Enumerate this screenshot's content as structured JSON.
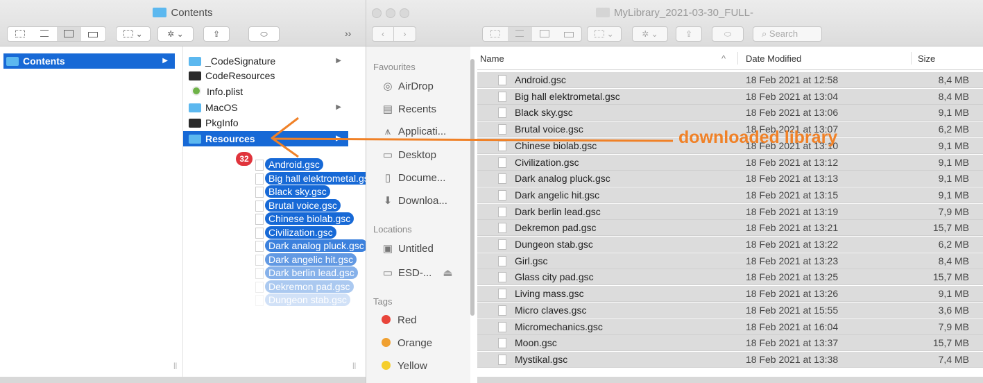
{
  "left_window": {
    "title": "Contents",
    "more_label": "››",
    "column1": [
      {
        "label": "Contents"
      }
    ],
    "column2": [
      {
        "label": "_CodeSignature",
        "icon": "folder-icon",
        "has_children": true
      },
      {
        "label": "CodeResources",
        "icon": "executable-icon",
        "has_children": false
      },
      {
        "label": "Info.plist",
        "icon": "plist-icon",
        "has_children": false
      },
      {
        "label": "MacOS",
        "icon": "folder-icon",
        "has_children": true
      },
      {
        "label": "PkgInfo",
        "icon": "executable-icon",
        "has_children": false
      },
      {
        "label": "Resources",
        "icon": "folder-icon",
        "has_children": true,
        "selected": true
      }
    ],
    "drag": {
      "count": "32",
      "items": [
        "Android.gsc",
        "Big hall elektrometal.gsc",
        "Black sky.gsc",
        "Brutal voice.gsc",
        "Chinese biolab.gsc",
        "Civilization.gsc",
        "Dark analog pluck.gsc",
        "Dark angelic hit.gsc",
        "Dark berlin lead.gsc",
        "Dekremon pad.gsc",
        "Dungeon stab.gsc"
      ]
    }
  },
  "right_window": {
    "title": "MyLibrary_2021-03-30_FULL-",
    "search_placeholder": "Search",
    "sidebar": {
      "favourites_header": "Favourites",
      "favourites": [
        {
          "label": "AirDrop",
          "icon": "airdrop-icon"
        },
        {
          "label": "Recents",
          "icon": "recents-icon"
        },
        {
          "label": "Applicati...",
          "icon": "applications-icon"
        },
        {
          "label": "Desktop",
          "icon": "desktop-icon"
        },
        {
          "label": "Docume...",
          "icon": "documents-icon"
        },
        {
          "label": "Downloa...",
          "icon": "downloads-icon"
        }
      ],
      "locations_header": "Locations",
      "locations": [
        {
          "label": "Untitled",
          "icon": "disk-icon"
        },
        {
          "label": "ESD-...",
          "icon": "disk-icon"
        }
      ],
      "eject_symbol": "⏏",
      "tags_header": "Tags",
      "tags": [
        {
          "label": "Red",
          "color": "#e8443a"
        },
        {
          "label": "Orange",
          "color": "#f0a030"
        },
        {
          "label": "Yellow",
          "color": "#f5ce2b"
        }
      ]
    },
    "list": {
      "columns": {
        "name": "Name",
        "date": "Date Modified",
        "size": "Size"
      },
      "sort_indicator": "^",
      "rows": [
        {
          "name": "Android.gsc",
          "date": "18 Feb 2021 at 12:58",
          "size": "8,4 MB"
        },
        {
          "name": "Big hall elektrometal.gsc",
          "date": "18 Feb 2021 at 13:04",
          "size": "8,4 MB"
        },
        {
          "name": "Black sky.gsc",
          "date": "18 Feb 2021 at 13:06",
          "size": "9,1 MB"
        },
        {
          "name": "Brutal voice.gsc",
          "date": "18 Feb 2021 at 13:07",
          "size": "6,2 MB"
        },
        {
          "name": "Chinese biolab.gsc",
          "date": "18 Feb 2021 at 13:10",
          "size": "9,1 MB"
        },
        {
          "name": "Civilization.gsc",
          "date": "18 Feb 2021 at 13:12",
          "size": "9,1 MB"
        },
        {
          "name": "Dark analog pluck.gsc",
          "date": "18 Feb 2021 at 13:13",
          "size": "9,1 MB"
        },
        {
          "name": "Dark angelic hit.gsc",
          "date": "18 Feb 2021 at 13:15",
          "size": "9,1 MB"
        },
        {
          "name": "Dark berlin lead.gsc",
          "date": "18 Feb 2021 at 13:19",
          "size": "7,9 MB"
        },
        {
          "name": "Dekremon pad.gsc",
          "date": "18 Feb 2021 at 13:21",
          "size": "15,7 MB"
        },
        {
          "name": "Dungeon stab.gsc",
          "date": "18 Feb 2021 at 13:22",
          "size": "6,2 MB"
        },
        {
          "name": "Girl.gsc",
          "date": "18 Feb 2021 at 13:23",
          "size": "8,4 MB"
        },
        {
          "name": "Glass city pad.gsc",
          "date": "18 Feb 2021 at 13:25",
          "size": "15,7 MB"
        },
        {
          "name": "Living mass.gsc",
          "date": "18 Feb 2021 at 13:26",
          "size": "9,1 MB"
        },
        {
          "name": "Micro claves.gsc",
          "date": "18 Feb 2021 at 15:55",
          "size": "3,6 MB"
        },
        {
          "name": "Micromechanics.gsc",
          "date": "18 Feb 2021 at 16:04",
          "size": "7,9 MB"
        },
        {
          "name": "Moon.gsc",
          "date": "18 Feb 2021 at 13:37",
          "size": "15,7 MB"
        },
        {
          "name": "Mystikal.gsc",
          "date": "18 Feb 2021 at 13:38",
          "size": "7,4 MB"
        }
      ]
    }
  },
  "annotation": {
    "text": "downloaded library",
    "color": "#f08127"
  }
}
